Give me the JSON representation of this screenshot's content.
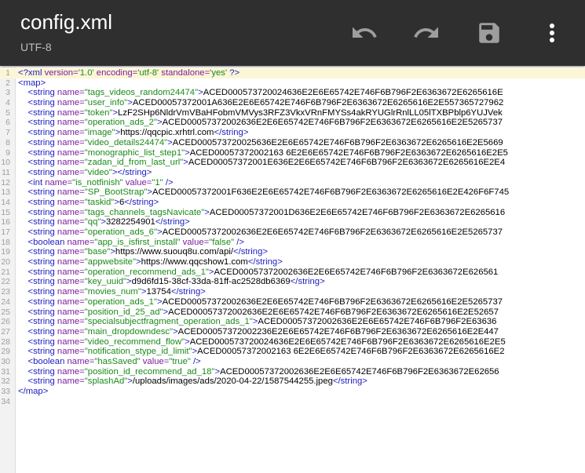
{
  "appbar": {
    "title": "config.xml",
    "encoding": "UTF-8",
    "actions": [
      "undo",
      "redo",
      "save",
      "more"
    ],
    "background": "#2f2f2f"
  },
  "editor": {
    "lines": [
      {
        "n": "1",
        "parts": [
          [
            "tag",
            "<?xml "
          ],
          [
            "attr",
            "version="
          ],
          [
            "str",
            "'1.0' "
          ],
          [
            "attr",
            "encoding="
          ],
          [
            "str",
            "'utf-8' "
          ],
          [
            "attr",
            "standalone="
          ],
          [
            "str",
            "'yes'"
          ],
          [
            "tag",
            " ?>"
          ]
        ]
      },
      {
        "n": "2",
        "parts": [
          [
            "tag",
            "<map>"
          ]
        ]
      },
      {
        "n": "3",
        "parts": [
          [
            "tag",
            "    <string "
          ],
          [
            "attr",
            "name="
          ],
          [
            "str",
            "\"tags_videos_random24474\""
          ],
          [
            "tag",
            ">"
          ],
          [
            "txt",
            "ACED000573720024636E2E6E65742E746F6B796F2E6363672E6265616E"
          ]
        ]
      },
      {
        "n": "4",
        "parts": [
          [
            "tag",
            "    <string "
          ],
          [
            "attr",
            "name="
          ],
          [
            "str",
            "\"user_info\""
          ],
          [
            "tag",
            ">"
          ],
          [
            "txt",
            "ACED00057372001A636E2E6E65742E746F6B796F2E6363672E6265616E2E557365727962"
          ]
        ]
      },
      {
        "n": "5",
        "parts": [
          [
            "tag",
            "    <string "
          ],
          [
            "attr",
            "name="
          ],
          [
            "str",
            "\"token\""
          ],
          [
            "tag",
            ">"
          ],
          [
            "txt",
            "LzF2SHp6NldrVmVBaHFobmVMVys3RFZ3VkxVRnFMYSs4akRYUGlrRnlLL05lTXBPblp6YUJVek"
          ]
        ]
      },
      {
        "n": "6",
        "parts": [
          [
            "tag",
            "    <string "
          ],
          [
            "attr",
            "name="
          ],
          [
            "str",
            "\"operation_ads_2\""
          ],
          [
            "tag",
            ">"
          ],
          [
            "txt",
            "ACED00057372002636E2E6E65742E746F6B796F2E6363672E6265616E2E5265737"
          ]
        ]
      },
      {
        "n": "7",
        "parts": [
          [
            "tag",
            "    <string "
          ],
          [
            "attr",
            "name="
          ],
          [
            "str",
            "\"image\""
          ],
          [
            "tag",
            ">"
          ],
          [
            "txt",
            "https://qqcpic.xrhtrl.com"
          ],
          [
            "tag",
            "</string>"
          ]
        ]
      },
      {
        "n": "8",
        "parts": [
          [
            "tag",
            "    <string "
          ],
          [
            "attr",
            "name="
          ],
          [
            "str",
            "\"video_details24474\""
          ],
          [
            "tag",
            ">"
          ],
          [
            "txt",
            "ACED000573720025636E2E6E65742E746F6B796F2E6363672E6265616E2E5669"
          ]
        ]
      },
      {
        "n": "9",
        "parts": [
          [
            "tag",
            "    <string "
          ],
          [
            "attr",
            "name="
          ],
          [
            "str",
            "\"monographic_list_step1\""
          ],
          [
            "tag",
            ">"
          ],
          [
            "txt",
            "ACED00057372002163 6E2E6E65742E746F6B796F2E6363672E6265616E2E5"
          ]
        ]
      },
      {
        "n": "10",
        "parts": [
          [
            "tag",
            "    <string "
          ],
          [
            "attr",
            "name="
          ],
          [
            "str",
            "\"zadan_id_from_last_url\""
          ],
          [
            "tag",
            ">"
          ],
          [
            "txt",
            "ACED00057372001E636E2E6E65742E746F6B796F2E6363672E6265616E2E4"
          ]
        ]
      },
      {
        "n": "11",
        "parts": [
          [
            "tag",
            "    <string "
          ],
          [
            "attr",
            "name="
          ],
          [
            "str",
            "\"video\""
          ],
          [
            "tag",
            "></string>"
          ]
        ]
      },
      {
        "n": "12",
        "parts": [
          [
            "tag",
            "    <int "
          ],
          [
            "attr",
            "name="
          ],
          [
            "str",
            "\"is_notfinish\" "
          ],
          [
            "attr",
            "value="
          ],
          [
            "str",
            "\"1\""
          ],
          [
            "tag",
            " />"
          ]
        ]
      },
      {
        "n": "13",
        "parts": [
          [
            "tag",
            "    <string "
          ],
          [
            "attr",
            "name="
          ],
          [
            "str",
            "\"SP_BootStrap\""
          ],
          [
            "tag",
            ">"
          ],
          [
            "txt",
            "ACED00057372001F636E2E6E65742E746F6B796F2E6363672E6265616E2E426F6F745"
          ]
        ]
      },
      {
        "n": "14",
        "parts": [
          [
            "tag",
            "    <string "
          ],
          [
            "attr",
            "name="
          ],
          [
            "str",
            "\"taskid\""
          ],
          [
            "tag",
            ">"
          ],
          [
            "txt",
            "6"
          ],
          [
            "tag",
            "</string>"
          ]
        ]
      },
      {
        "n": "15",
        "parts": [
          [
            "tag",
            "    <string "
          ],
          [
            "attr",
            "name="
          ],
          [
            "str",
            "\"tags_channels_tagsNavicate\""
          ],
          [
            "tag",
            ">"
          ],
          [
            "txt",
            "ACED00057372001D636E2E6E65742E746F6B796F2E6363672E6265616"
          ]
        ]
      },
      {
        "n": "16",
        "parts": [
          [
            "tag",
            "    <string "
          ],
          [
            "attr",
            "name="
          ],
          [
            "str",
            "\"qq\""
          ],
          [
            "tag",
            ">"
          ],
          [
            "txt",
            "3282254901"
          ],
          [
            "tag",
            "</string>"
          ]
        ]
      },
      {
        "n": "17",
        "parts": [
          [
            "tag",
            "    <string "
          ],
          [
            "attr",
            "name="
          ],
          [
            "str",
            "\"operation_ads_6\""
          ],
          [
            "tag",
            ">"
          ],
          [
            "txt",
            "ACED00057372002636E2E6E65742E746F6B796F2E6363672E6265616E2E5265737"
          ]
        ]
      },
      {
        "n": "18",
        "parts": [
          [
            "tag",
            "    <boolean "
          ],
          [
            "attr",
            "name="
          ],
          [
            "str",
            "\"app_is_isfirst_install\" "
          ],
          [
            "attr",
            "value="
          ],
          [
            "str",
            "\"false\""
          ],
          [
            "tag",
            " />"
          ]
        ]
      },
      {
        "n": "19",
        "parts": [
          [
            "tag",
            "    <string "
          ],
          [
            "attr",
            "name="
          ],
          [
            "str",
            "\"base\""
          ],
          [
            "tag",
            ">"
          ],
          [
            "txt",
            "https://www.suouq8u.com/api/"
          ],
          [
            "tag",
            "</string>"
          ]
        ]
      },
      {
        "n": "20",
        "parts": [
          [
            "tag",
            "    <string "
          ],
          [
            "attr",
            "name="
          ],
          [
            "str",
            "\"appwebsite\""
          ],
          [
            "tag",
            ">"
          ],
          [
            "txt",
            "https://www.qqcshow1.com"
          ],
          [
            "tag",
            "</string>"
          ]
        ]
      },
      {
        "n": "21",
        "parts": [
          [
            "tag",
            "    <string "
          ],
          [
            "attr",
            "name="
          ],
          [
            "str",
            "\"operation_recommend_ads_1\""
          ],
          [
            "tag",
            ">"
          ],
          [
            "txt",
            "ACED00057372002636E2E6E65742E746F6B796F2E6363672E626561"
          ]
        ]
      },
      {
        "n": "22",
        "parts": [
          [
            "tag",
            "    <string "
          ],
          [
            "attr",
            "name="
          ],
          [
            "str",
            "\"key_uuid\""
          ],
          [
            "tag",
            ">"
          ],
          [
            "txt",
            "d9d6fd15-38cf-33da-81ff-ac2528db6369"
          ],
          [
            "tag",
            "</string>"
          ]
        ]
      },
      {
        "n": "23",
        "parts": [
          [
            "tag",
            "    <string "
          ],
          [
            "attr",
            "name="
          ],
          [
            "str",
            "\"movies_num\""
          ],
          [
            "tag",
            ">"
          ],
          [
            "txt",
            "13754"
          ],
          [
            "tag",
            "</string>"
          ]
        ]
      },
      {
        "n": "24",
        "parts": [
          [
            "tag",
            "    <string "
          ],
          [
            "attr",
            "name="
          ],
          [
            "str",
            "\"operation_ads_1\""
          ],
          [
            "tag",
            ">"
          ],
          [
            "txt",
            "ACED00057372002636E2E6E65742E746F6B796F2E6363672E6265616E2E5265737"
          ]
        ]
      },
      {
        "n": "25",
        "parts": [
          [
            "tag",
            "    <string "
          ],
          [
            "attr",
            "name="
          ],
          [
            "str",
            "\"position_id_25_ad\""
          ],
          [
            "tag",
            ">"
          ],
          [
            "txt",
            "ACED00057372002636E2E6E65742E746F6B796F2E6363672E6265616E2E52657"
          ]
        ]
      },
      {
        "n": "26",
        "parts": [
          [
            "tag",
            "    <string "
          ],
          [
            "attr",
            "name="
          ],
          [
            "str",
            "\"specialsubjectfragment_operation_ads_1\""
          ],
          [
            "tag",
            ">"
          ],
          [
            "txt",
            "ACED00057372002636E2E6E65742E746F6B796F2E63636"
          ]
        ]
      },
      {
        "n": "27",
        "parts": [
          [
            "tag",
            "    <string "
          ],
          [
            "attr",
            "name="
          ],
          [
            "str",
            "\"main_dropdowndesc\""
          ],
          [
            "tag",
            ">"
          ],
          [
            "txt",
            "ACED00057372002236E2E6E65742E746F6B796F2E6363672E6265616E2E447"
          ]
        ]
      },
      {
        "n": "28",
        "parts": [
          [
            "tag",
            "    <string "
          ],
          [
            "attr",
            "name="
          ],
          [
            "str",
            "\"video_recommend_flow\""
          ],
          [
            "tag",
            ">"
          ],
          [
            "txt",
            "ACED000573720024636E2E6E65742E746F6B796F2E6363672E6265616E2E5"
          ]
        ]
      },
      {
        "n": "29",
        "parts": [
          [
            "tag",
            "    <string "
          ],
          [
            "attr",
            "name="
          ],
          [
            "str",
            "\"notification_stype_id_limit\""
          ],
          [
            "tag",
            ">"
          ],
          [
            "txt",
            "ACED00057372002163 6E2E6E65742E746F6B796F2E6363672E6265616E2"
          ]
        ]
      },
      {
        "n": "30",
        "parts": [
          [
            "tag",
            "    <boolean "
          ],
          [
            "attr",
            "name="
          ],
          [
            "str",
            "\"hasSaved\" "
          ],
          [
            "attr",
            "value="
          ],
          [
            "str",
            "\"true\""
          ],
          [
            "tag",
            " />"
          ]
        ]
      },
      {
        "n": "31",
        "parts": [
          [
            "tag",
            "    <string "
          ],
          [
            "attr",
            "name="
          ],
          [
            "str",
            "\"position_id_recommend_ad_18\""
          ],
          [
            "tag",
            ">"
          ],
          [
            "txt",
            "ACED00057372002636E2E6E65742E746F6B796F2E6363672E62656"
          ]
        ]
      },
      {
        "n": "32",
        "parts": [
          [
            "tag",
            "    <string "
          ],
          [
            "attr",
            "name="
          ],
          [
            "str",
            "\"splashAd\""
          ],
          [
            "tag",
            ">"
          ],
          [
            "txt",
            "/uploads/images/ads/2020-04-22/1587544255.jpeg"
          ],
          [
            "tag",
            "</string>"
          ]
        ]
      },
      {
        "n": "33",
        "parts": [
          [
            "tag",
            "</map>"
          ]
        ]
      },
      {
        "n": "34",
        "parts": []
      }
    ]
  }
}
